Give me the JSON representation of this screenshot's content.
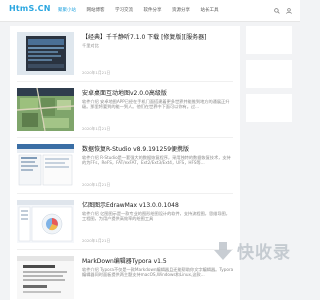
{
  "site": {
    "logo": "HtmS.CN"
  },
  "nav": {
    "items": [
      "聚聚小站",
      "网站博客",
      "学习交流",
      "软件分享",
      "资源分享",
      "站长工具"
    ]
  },
  "colors": {
    "accent": "#2aa6e0"
  },
  "icons": [
    "search-icon",
    "user-icon"
  ],
  "posts": [
    {
      "title": "【经典】千千静听7.1.0 下载 [修复版][服务器]",
      "desc": "千里对比",
      "date": "2020年1月21日",
      "meta": "",
      "thumb": "player"
    },
    {
      "title": "安卓桌面互动地图v2.0.0高级版",
      "desc": "软件介绍 安卓地图APP已经在手机门面搭建着更多世界并能推到地方的通展正升级。那里将要到的能一到人。他们在世界中下面可以你有。过...",
      "date": "2020年1月21日",
      "meta": "",
      "thumb": "map"
    },
    {
      "title": "数据恢复R-Studio v8.9.191259便携版",
      "desc": "软件介绍 R-Studio是一套强大的数据恢复程序，采用独特的数据恢复技术，支持的为FFs，ReFS，FAT/exFAT，Ext2/Ext3/Ext4，UFS，HFS等...",
      "date": "2020年1月21日",
      "meta": "",
      "thumb": "rstudio"
    },
    {
      "title": "亿图图示EdrawMax v13.0.0.1048",
      "desc": "软件介绍 亿图图示是一款专业的图形绘图设计的软件，支持流程图，思维导图，工程图，为用户提供高效率的绘图工具",
      "date": "2020年1月21日",
      "meta": "",
      "thumb": "edraw"
    },
    {
      "title": "MarkDown编辑器Typora v1.5",
      "desc": "软件介绍 Typora不仅是一款Markdown编辑器且还能帮助你文字编辑器。Typora编辑器同时面板提供两主题支持macOS,Windows和Linux,这款...",
      "date": "",
      "meta": "",
      "thumb": "typora"
    }
  ],
  "watermark": {
    "text": "快收录"
  }
}
